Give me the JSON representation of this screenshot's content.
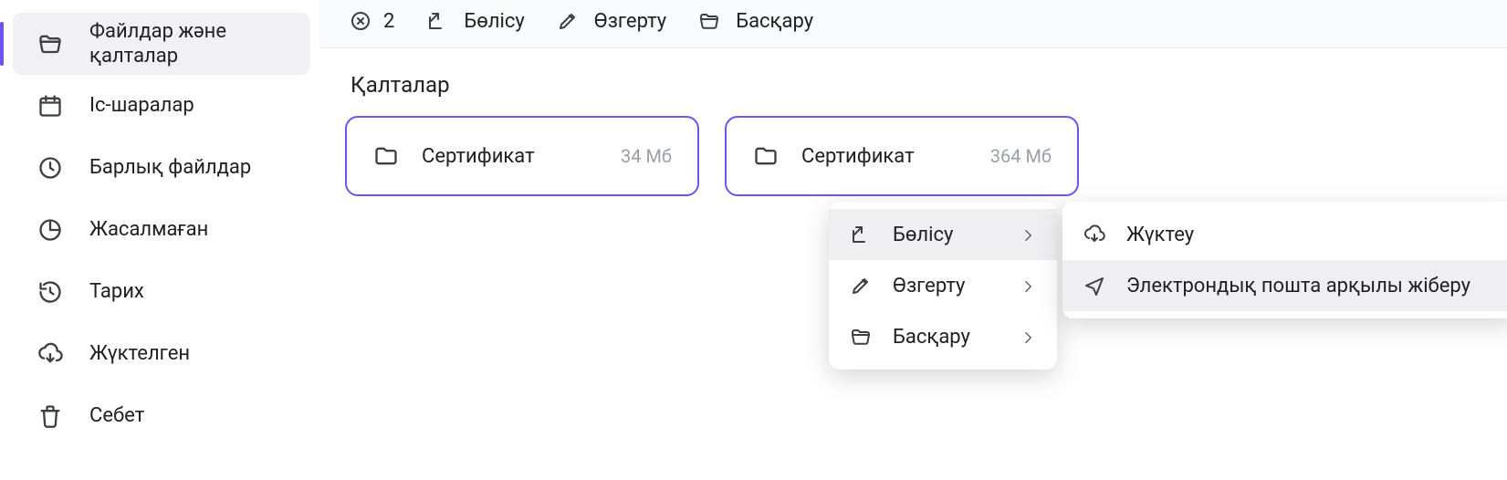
{
  "sidebar": {
    "items": [
      {
        "label": "Файлдар және қалталар"
      },
      {
        "label": "Іс-шаралар"
      },
      {
        "label": "Барлық файлдар"
      },
      {
        "label": "Жасалмаған"
      },
      {
        "label": "Тарих"
      },
      {
        "label": "Жүктелген"
      },
      {
        "label": "Себет"
      }
    ]
  },
  "toolbar": {
    "selected_count": "2",
    "share_label": "Бөлісу",
    "edit_label": "Өзгерту",
    "manage_label": "Басқару"
  },
  "main": {
    "section_title": "Қалталар",
    "folders": [
      {
        "name": "Сертификат",
        "size": "34 Мб"
      },
      {
        "name": "Сертификат",
        "size": "364 Мб"
      }
    ]
  },
  "context_menu": {
    "primary": [
      {
        "label": "Бөлісу"
      },
      {
        "label": "Өзгерту"
      },
      {
        "label": "Басқару"
      }
    ],
    "secondary": [
      {
        "label": "Жүктеу"
      },
      {
        "label": "Электрондық пошта арқылы жіберу"
      }
    ]
  }
}
